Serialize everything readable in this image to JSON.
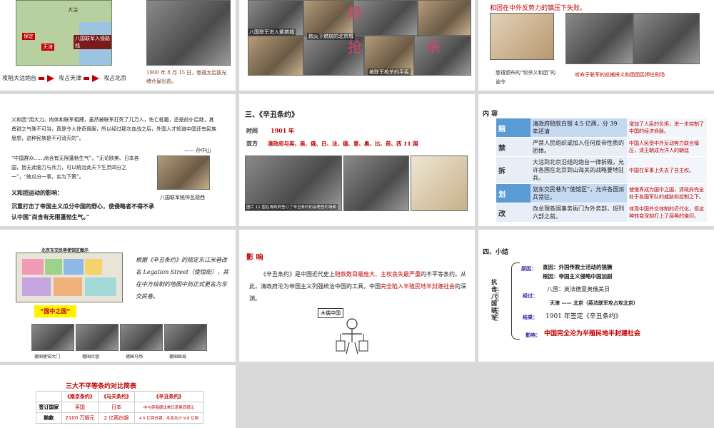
{
  "slide1": {
    "map_labels": [
      "大沽",
      "保定",
      "天津",
      "八国联军入侵路线"
    ],
    "flow": [
      "攻陷大沽炮台",
      "攻占天津",
      "攻占北京"
    ],
    "photo_caption": "1900 年 8 月 15 日，慈禧太后挟光绪仓皇出逃。"
  },
  "slide2": {
    "captions": [
      "八国联军进入紫禁城",
      "炮火下燃烧的北京城",
      "被联军枪杀的平民"
    ],
    "red_chars": [
      "烧",
      "抢",
      "杀"
    ]
  },
  "slide3": {
    "header_text": "和团在中外反势力的镇压下失败。",
    "caption_left": "慈禧颁布的“绞杀义和团”的谕令",
    "caption_right": "听命于联军的巡捕将义和团团民押往刑场"
  },
  "slide4": {
    "para": "义和团“用大刀、肉体和联军相搏，虽然被联军打死了几万人，伤亡枕籍，还是前仆后继，其勇锐之气殊不可当，真是令人惊奇佩服，所以经过那次血战之后，外国人才知道中国还有民族思想，这种民族是不可消灭的”。",
    "author": "—— 孙中山",
    "quote": "“中国群众……尚含有无限蓬勃生气”，“无论欧美、日本各国，皆无此脑力与兵力，可以统治此天下生灵四分之一”，“故瓜分一事，实为下策”。",
    "portrait_caption": "八国联军统帅瓦德西",
    "impact_title": "义和团运动的影响：",
    "impact_text": "沉重打击了帝国主义瓜分中国的野心，使侵略者不得不承认中国“尚含有无限蓬勃生气。”"
  },
  "slide5": {
    "title": "三、《辛丑条约》",
    "time_label": "时间",
    "time_value": "1901 年",
    "parties_label": "双方",
    "parties_value": "清政府与英、美、俄、日、法、德、意、奥、比、荷、西 11 国",
    "photo_caption": "图片 11 国在清政府签订了辛丑条约的会晤签约场面"
  },
  "slide6": {
    "title": "内 容",
    "rows": [
      {
        "key": "赔",
        "detail": "清政府赔款白银 4.5 亿两，分 39 年还清",
        "effect": "增加了人民的负担，进一步控制了中国的经济命脉。"
      },
      {
        "key": "禁",
        "detail": "严禁人民组织或加入任何反帝性质的团体。",
        "effect": "中国人民受中外反动势力联合镇压，清王朝成为洋人的朝廷"
      },
      {
        "key": "拆",
        "detail": "大沽到北京沿线的炮台一律拆毁，允许各国在北京到山海关的战略要地驻兵。",
        "effect": "中国在军事上失去了自主权。"
      },
      {
        "key": "划",
        "detail": "划东交民巷为“使馆区”，允许各国派兵常驻。",
        "effect": "使馆界成为国中之国，清政府完全处于各国军队的威胁和控制之下。"
      },
      {
        "key": "改",
        "detail": "改总理各国事务衙门为外务部，班列六部之前。",
        "effect": "体现中国外交体制的近代化，但这种转变深刻打上了屈辱的烙印。"
      }
    ]
  },
  "slide7": {
    "map_title": "北京东交民巷使馆区图示",
    "para": "根据《辛丑条约》的规定东江米巷改名 Legation Street（使馆街），其在中方绘制的地图中则正式更名为东交民巷。",
    "badge": "“国中之国”",
    "photo_captions": [
      "德国使馆大门",
      "德国兵营",
      "德国马场",
      "德国邮局"
    ]
  },
  "slide8": {
    "title": "影 响",
    "para_prefix": "《辛丑条约》是中国近代史上",
    "para_red1": "赔款数目最庞大、主权丧失最严重",
    "para_mid": "的不平等条约。从此，清政府沦为帝国主义列强统治中国的工具，中国",
    "para_red2": "完全陷入半殖民地半封建社会",
    "para_suffix": "的深渊。",
    "cartoon_label": "木偶中国"
  },
  "slide9": {
    "title": "四、小结",
    "side_label": "抗击八国联军",
    "years": "（1900—1901）",
    "reason_label": "原因：",
    "reason_direct": "直因：外国传教士活动的猖獗",
    "reason_root": "根因：帝国主义侵略中国加剧",
    "process_label": "经过：",
    "process_1": "八国：英法德意奥俄美日",
    "process_2": "天津 —— 北京（英法联军攻占攻北京）",
    "result_label": "结果：",
    "result_text": "1901 年签定《辛丑条约》",
    "impact_label": "影响：",
    "impact_text": "中国完全沦为半殖民地半封建社会"
  },
  "slide10": {
    "title": "三大不平等条约对比简表",
    "headers": [
      "",
      "《南京条约》",
      "《马关条约》",
      "《辛丑条约》"
    ],
    "rows": [
      [
        "签订国家",
        "英国",
        "日本",
        "中与英俄德法美日意奥西荷比"
      ],
      [
        "赔款",
        "2100 万银元",
        "2 亿两白银",
        "4.5 亿两白银，本息共计 9.8 亿两"
      ]
    ]
  }
}
